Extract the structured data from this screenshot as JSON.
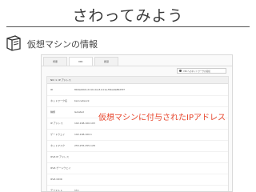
{
  "slide": {
    "title": "さわってみよう",
    "section_heading": "仮想マシンの情報",
    "callout": "仮想マシンに付与されたIPアドレス"
  },
  "ui": {
    "tabs": [
      {
        "label": "概要"
      },
      {
        "label": "NIC"
      },
      {
        "label": "履歴"
      }
    ],
    "toolbar_button": "VNI へのネットワークの接続",
    "panel_title": "NIC 1: IP アドレス",
    "rows": [
      {
        "label": "ID",
        "value": "8b6a22b9-2110-4ca3-b11e-f9ba9a86d5f7"
      },
      {
        "label": "ネットワーク名",
        "value": "bsd-network"
      },
      {
        "label": "種類",
        "value": "Isolated"
      },
      {
        "label": "IP アドレス",
        "value": "192.168.100.103"
      },
      {
        "label": "ゲートウェイ",
        "value": "192.168.100.1"
      },
      {
        "label": "ネットマスク",
        "value": "255.255.255.128"
      },
      {
        "label": "IPv6 IP アドレス",
        "value": ""
      },
      {
        "label": "IPv6 ゲートウェイ",
        "value": ""
      },
      {
        "label": "IPv6 CIDR",
        "value": ""
      },
      {
        "label": "デフォルト",
        "value": "はい"
      }
    ]
  },
  "colors": {
    "callout": "#e8472e",
    "title": "#3a3a3a"
  },
  "icons": {
    "section_icon": "book-icon"
  }
}
